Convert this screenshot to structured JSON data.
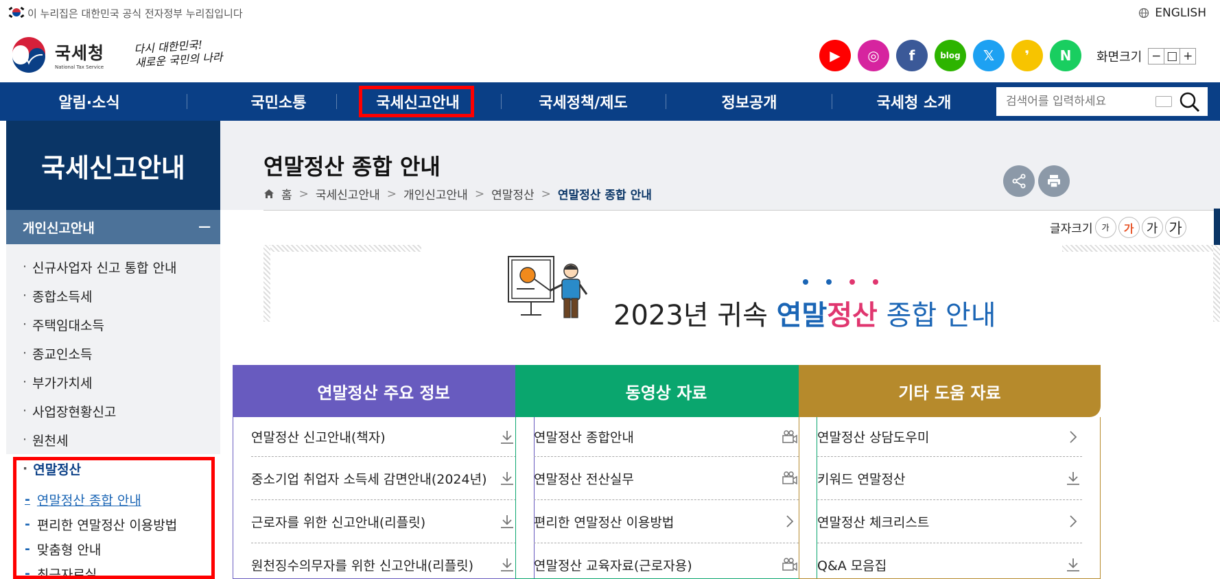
{
  "gov_banner": {
    "text": "이 누리집은 대한민국 공식 전자정부 누리집입니다",
    "english": "ENGLISH"
  },
  "header": {
    "logo_ko": "국세청",
    "logo_en": "National Tax Service",
    "slogan_line1": "다시 대한민국!",
    "slogan_line2": "새로운 국민의 나라",
    "sns": [
      {
        "name": "youtube",
        "color": "#ff0000",
        "glyph": "▶"
      },
      {
        "name": "instagram",
        "color": "#d6249f",
        "glyph": "◎"
      },
      {
        "name": "facebook",
        "color": "#3b5998",
        "glyph": "f"
      },
      {
        "name": "blog",
        "color": "#2db400",
        "glyph": "blog"
      },
      {
        "name": "x",
        "color": "#1da1f2",
        "glyph": "𝕏"
      },
      {
        "name": "kakao",
        "color": "#f7c400",
        "glyph": "❜"
      },
      {
        "name": "naver",
        "color": "#19ce60",
        "glyph": "N"
      }
    ],
    "screen_size_label": "화면크기",
    "screen_size_btns": [
      "−",
      "□",
      "+"
    ]
  },
  "gnb": {
    "items": [
      "알림·소식",
      "국민소통",
      "국세신고안내",
      "국세정책/제도",
      "정보공개",
      "국세청 소개"
    ],
    "search_placeholder": "검색어를 입력하세요"
  },
  "lnb": {
    "title": "국세신고안내",
    "section": "개인신고안내",
    "section_toggle": "−",
    "items": [
      "신규사업자 신고 통합 안내",
      "종합소득세",
      "주택임대소득",
      "종교인소득",
      "부가가치세",
      "사업장현황신고",
      "원천세",
      "연말정산"
    ],
    "sub_items": [
      "연말정산 종합 안내",
      "편리한 연말정산 이용방법",
      "맞춤형 안내",
      "최근자료실"
    ]
  },
  "page": {
    "title": "연말정산 종합 안내",
    "breadcrumb": [
      "홈",
      "국세신고안내",
      "개인신고안내",
      "연말정산",
      "연말정산 종합 안내"
    ],
    "font_size_label": "글자크기",
    "font_size_options": [
      "가",
      "가",
      "가",
      "가"
    ],
    "banner": {
      "pre": "2023년 귀속 ",
      "blue": "연말",
      "red": "정산",
      "post": " 종합 안내"
    }
  },
  "columns": [
    {
      "title": "연말정산 주요 정보",
      "color": "#685bbf",
      "rows": [
        {
          "label": "연말정산 신고안내(책자)",
          "icon": "download-icon"
        },
        {
          "label": "중소기업 취업자 소득세 감면안내(2024년)",
          "icon": "download-icon"
        },
        {
          "label": "근로자를 위한 신고안내(리플릿)",
          "icon": "download-icon"
        },
        {
          "label": "원천징수의무자를 위한 신고안내(리플릿)",
          "icon": "download-icon"
        }
      ]
    },
    {
      "title": "동영상 자료",
      "color": "#0aa66e",
      "rows": [
        {
          "label": "연말정산 종합안내",
          "icon": "video-icon"
        },
        {
          "label": "연말정산 전산실무",
          "icon": "video-icon"
        },
        {
          "label": "편리한 연말정산 이용방법",
          "icon": "chevron-right-icon"
        },
        {
          "label": "연말정산 교육자료(근로자용)",
          "icon": "video-icon"
        }
      ]
    },
    {
      "title": "기타 도움 자료",
      "color": "#b68a2c",
      "rows": [
        {
          "label": "연말정산 상담도우미",
          "icon": "chevron-right-icon"
        },
        {
          "label": "키워드 연말정산",
          "icon": "download-icon"
        },
        {
          "label": "연말정산 체크리스트",
          "icon": "chevron-right-icon"
        },
        {
          "label": "Q&A 모음집",
          "icon": "download-icon"
        }
      ]
    }
  ]
}
